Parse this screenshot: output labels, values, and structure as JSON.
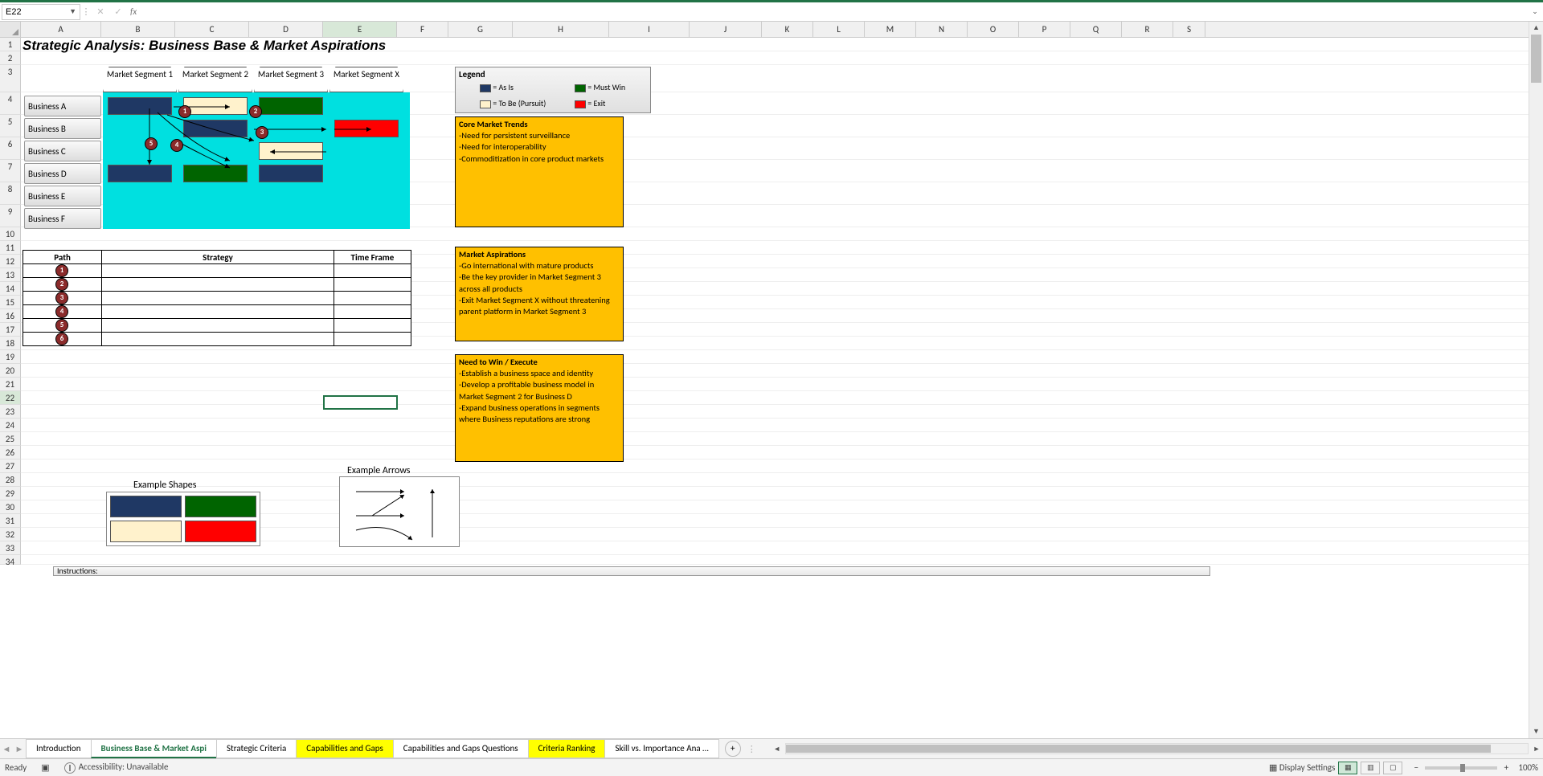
{
  "name_box": "E22",
  "formula_value": "",
  "title": "Strategic Analysis:  Business Base & Market Aspirations",
  "columns": [
    "A",
    "B",
    "C",
    "D",
    "E",
    "F",
    "G",
    "H",
    "I",
    "J",
    "K",
    "L",
    "M",
    "N",
    "O",
    "P",
    "Q",
    "R",
    "S"
  ],
  "segments": [
    "Market Segment 1",
    "Market Segment 2",
    "Market Segment 3",
    "Market Segment X"
  ],
  "businesses": [
    "Business A",
    "Business B",
    "Business C",
    "Business D",
    "Business E",
    "Business F"
  ],
  "legend": {
    "title": "Legend",
    "as_is": "= As Is",
    "must_win": "= Must Win",
    "to_be": "= To Be (Pursuit)",
    "exit": "= Exit"
  },
  "trends": {
    "title": "Core Market Trends",
    "items": [
      "-Need for persistent surveillance",
      "-Need for interoperability",
      "-Commoditization in core product markets"
    ]
  },
  "aspirations": {
    "title": "Market Aspirations",
    "items": [
      "-Go international with mature products",
      "-Be the key provider in Market Segment 3 across all products",
      "-Exit Market Segment X without threatening parent platform in Market Segment 3"
    ]
  },
  "win": {
    "title": "Need to Win / Execute",
    "items": [
      "-Establish a business space and identity",
      "-Develop a profitable business model in Market Segment 2 for Business D",
      "-Expand business operations in segments where Business reputations are strong"
    ]
  },
  "path_table": {
    "headers": {
      "path": "Path",
      "strategy": "Strategy",
      "time": "Time Frame"
    },
    "rows": [
      "1",
      "2",
      "3",
      "4",
      "5",
      "6"
    ]
  },
  "example_shapes_label": "Example Shapes",
  "example_arrows_label": "Example Arrows",
  "instructions_label": "Instructions:",
  "tabs": {
    "items": [
      {
        "label": "Introduction",
        "active": false,
        "yellow": false
      },
      {
        "label": "Business Base & Market Aspi",
        "active": true,
        "yellow": false
      },
      {
        "label": "Strategic Criteria",
        "active": false,
        "yellow": false
      },
      {
        "label": "Capabilities and Gaps",
        "active": false,
        "yellow": true
      },
      {
        "label": "Capabilities and Gaps Questions",
        "active": false,
        "yellow": false
      },
      {
        "label": "Criteria Ranking",
        "active": false,
        "yellow": true
      },
      {
        "label": "Skill vs. Importance Ana …",
        "active": false,
        "yellow": false
      }
    ]
  },
  "status": {
    "ready": "Ready",
    "accessibility": "Accessibility: Unavailable",
    "display": "Display Settings",
    "zoom": "100%"
  }
}
